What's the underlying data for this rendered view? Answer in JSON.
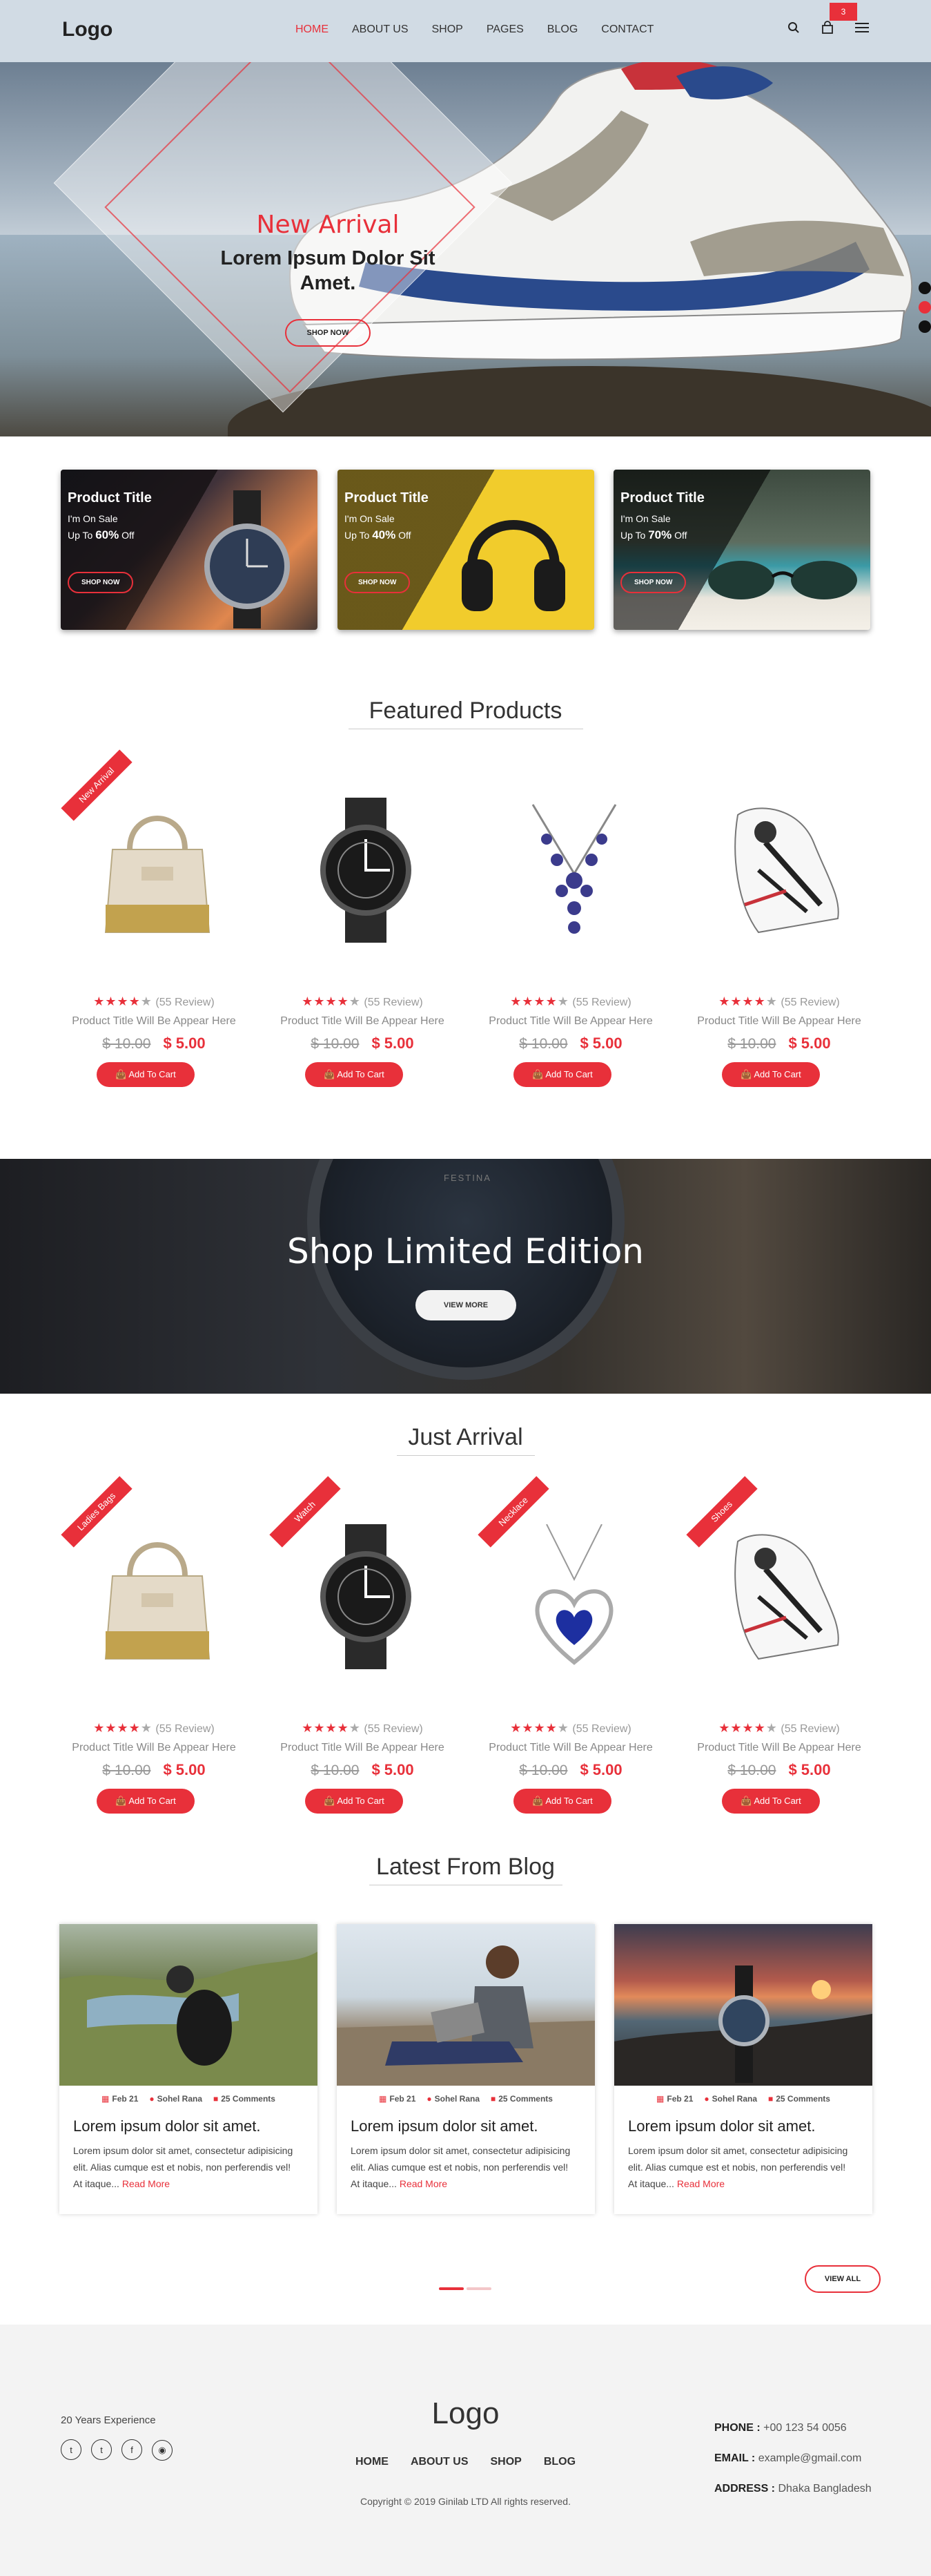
{
  "header": {
    "logo": "Logo",
    "nav": [
      "HOME",
      "ABOUT US",
      "SHOP",
      "PAGES",
      "BLOG",
      "CONTACT"
    ],
    "cart_count": "3"
  },
  "hero": {
    "kicker": "New Arrival",
    "title": "Lorem Ipsum Dolor Sit Amet.",
    "button": "SHOP NOW"
  },
  "promos": [
    {
      "title": "Product Title",
      "sale": "I'm On Sale",
      "upto": "Up To",
      "pct": "60%",
      "off": "Off",
      "button": "SHOP NOW"
    },
    {
      "title": "Product Title",
      "sale": "I'm On Sale",
      "upto": "Up To",
      "pct": "40%",
      "off": "Off",
      "button": "SHOP NOW"
    },
    {
      "title": "Product Title",
      "sale": "I'm On Sale",
      "upto": "Up To",
      "pct": "70%",
      "off": "Off",
      "button": "SHOP NOW"
    }
  ],
  "featured": {
    "title": "Featured Products",
    "ribbon": "New Arrival",
    "items": [
      {
        "reviews": "(55 Review)",
        "name": "Product Title Will Be Appear Here",
        "old_price": "$ 10.00",
        "price": "$ 5.00",
        "button": "Add To Cart",
        "rating": 4
      },
      {
        "reviews": "(55 Review)",
        "name": "Product Title Will Be Appear Here",
        "old_price": "$ 10.00",
        "price": "$ 5.00",
        "button": "Add To Cart",
        "rating": 4
      },
      {
        "reviews": "(55 Review)",
        "name": "Product Title Will Be Appear Here",
        "old_price": "$ 10.00",
        "price": "$ 5.00",
        "button": "Add To Cart",
        "rating": 4
      },
      {
        "reviews": "(55 Review)",
        "name": "Product Title Will Be Appear Here",
        "old_price": "$ 10.00",
        "price": "$ 5.00",
        "button": "Add To Cart",
        "rating": 4
      }
    ]
  },
  "limited": {
    "brand": "FESTINA",
    "title": "Shop Limited Edition",
    "button": "VIEW MORE"
  },
  "arrival": {
    "title": "Just Arrival",
    "ribbons": [
      "Ladies Bags",
      "Watch",
      "Necklace",
      "Shoes"
    ],
    "items": [
      {
        "reviews": "(55 Review)",
        "name": "Product Title Will Be Appear Here",
        "old_price": "$ 10.00",
        "price": "$ 5.00",
        "button": "Add To Cart",
        "rating": 4
      },
      {
        "reviews": "(55 Review)",
        "name": "Product Title Will Be Appear Here",
        "old_price": "$ 10.00",
        "price": "$ 5.00",
        "button": "Add To Cart",
        "rating": 4
      },
      {
        "reviews": "(55 Review)",
        "name": "Product Title Will Be Appear Here",
        "old_price": "$ 10.00",
        "price": "$ 5.00",
        "button": "Add To Cart",
        "rating": 4
      },
      {
        "reviews": "(55 Review)",
        "name": "Product Title Will Be Appear Here",
        "old_price": "$ 10.00",
        "price": "$ 5.00",
        "button": "Add To Cart",
        "rating": 4
      }
    ]
  },
  "blog": {
    "title": "Latest From Blog",
    "posts": [
      {
        "date": "Feb 21",
        "author": "Sohel Rana",
        "comments": "25 Comments",
        "title": "Lorem ipsum dolor sit amet.",
        "excerpt": "Lorem ipsum dolor sit amet, consectetur adipisicing elit. Alias cumque est et nobis, non perferendis vel! At itaque...",
        "read_more": "Read More"
      },
      {
        "date": "Feb 21",
        "author": "Sohel Rana",
        "comments": "25 Comments",
        "title": "Lorem ipsum dolor sit amet.",
        "excerpt": "Lorem ipsum dolor sit amet, consectetur adipisicing elit. Alias cumque est et nobis, non perferendis vel! At itaque...",
        "read_more": "Read More"
      },
      {
        "date": "Feb 21",
        "author": "Sohel Rana",
        "comments": "25 Comments",
        "title": "Lorem ipsum dolor sit amet.",
        "excerpt": "Lorem ipsum dolor sit amet, consectetur adipisicing elit. Alias cumque est et nobis, non perferendis vel! At itaque...",
        "read_more": "Read More"
      }
    ],
    "view_all": "VIEW ALL"
  },
  "footer": {
    "experience": "20 Years Experience",
    "logo": "Logo",
    "nav": [
      "HOME",
      "ABOUT US",
      "SHOP",
      "BLOG"
    ],
    "copyright": "Copyright © 2019 Ginilab LTD All rights reserved.",
    "phone_label": "PHONE :",
    "phone": "+00 123 54 0056",
    "email_label": "EMAIL :",
    "email": "example@gmail.com",
    "address_label": "ADDRESS :",
    "address": "Dhaka Bangladesh"
  },
  "colors": {
    "accent": "#e8303a",
    "footer_bg": "#f3f3f3"
  }
}
